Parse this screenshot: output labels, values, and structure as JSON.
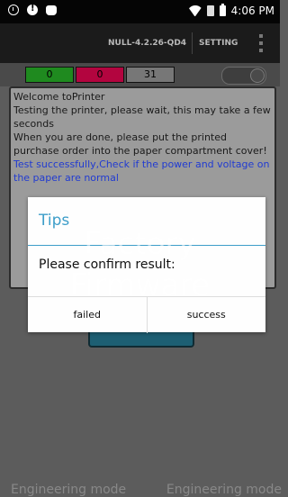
{
  "status_bar": {
    "time": "4:06 PM",
    "icons": [
      "clock-icon",
      "alert-icon",
      "debug-icon",
      "wifi-icon",
      "sim-icon",
      "battery-icon"
    ]
  },
  "action_bar": {
    "version": "NULL-4.2.26-QD4",
    "setting_label": "SETTING",
    "overflow_icon": "overflow-menu-icon"
  },
  "counters": {
    "success_count": "0",
    "fail_count": "0",
    "total_count": "31",
    "colors": {
      "success": "#1f8a1f",
      "fail": "#b3053f",
      "total": "#777777"
    }
  },
  "log": {
    "lines": [
      "    Welcome toPrinter",
      "    Testing the printer, please wait, this may take a few seconds",
      "    When you are done, please put the printed purchase order into the paper compartment cover!"
    ],
    "result_line": "    Test successfully,Check if the power and voltage on the paper are normal",
    "result_color": "#213bd1"
  },
  "dialog": {
    "title": "Tips",
    "message": "Please confirm result:",
    "failed_label": "failed",
    "success_label": "success",
    "accent_color": "#3e9ec9"
  },
  "watermark": {
    "line1": "Factory",
    "line2": "Firmware"
  },
  "footer": {
    "left_label": "Engineering mode",
    "right_label": "Engineering mode"
  }
}
